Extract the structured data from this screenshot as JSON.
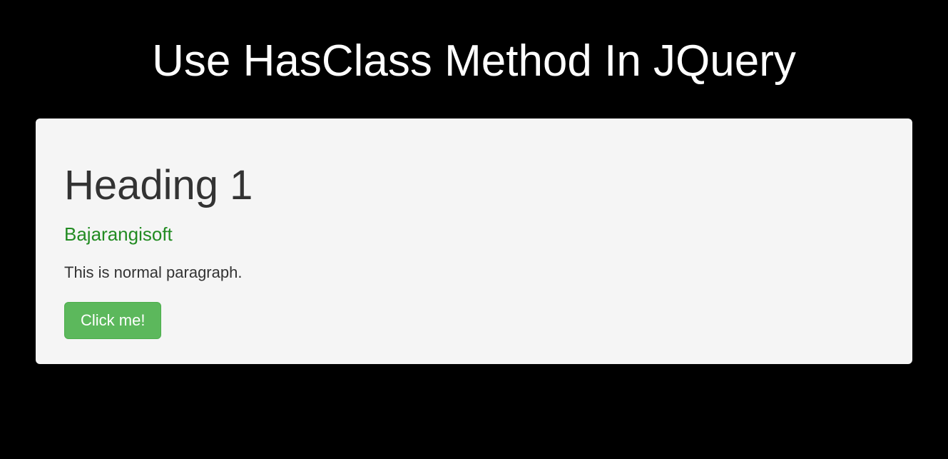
{
  "page": {
    "title": "Use HasClass Method In JQuery"
  },
  "card": {
    "heading": "Heading 1",
    "subtitle": "Bajarangisoft",
    "paragraph": "This is normal paragraph.",
    "button_label": "Click me!"
  }
}
